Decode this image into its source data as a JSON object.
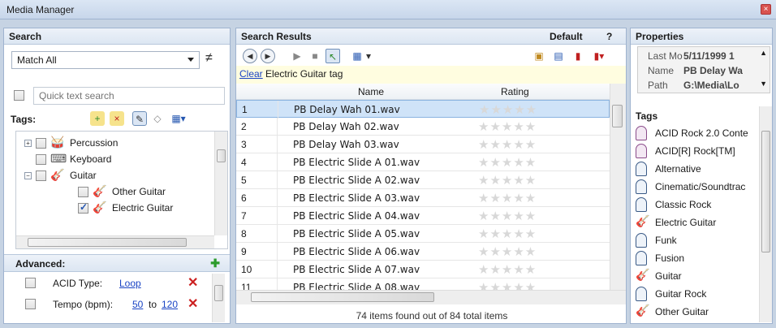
{
  "window": {
    "title": "Media Manager"
  },
  "search": {
    "header": "Search",
    "match_mode": "Match All",
    "not_equal_symbol": "≠",
    "quick_placeholder": "Quick text search",
    "tags_label": "Tags:",
    "tree": [
      {
        "label": "Percussion",
        "expander": "+",
        "checked": false,
        "icon": "drum-icon"
      },
      {
        "label": "Keyboard",
        "expander": "",
        "checked": false,
        "icon": "keyboard-icon"
      },
      {
        "label": "Guitar",
        "expander": "−",
        "checked": false,
        "icon": "guitar-icon"
      },
      {
        "label": "Other Guitar",
        "expander": "",
        "checked": false,
        "icon": "guitar-icon"
      },
      {
        "label": "Electric Guitar",
        "expander": "",
        "checked": true,
        "icon": "guitar-icon"
      }
    ],
    "advanced": {
      "label": "Advanced:",
      "acid_type_label": "ACID Type:",
      "acid_type_value": "Loop",
      "tempo_label": "Tempo (bpm):",
      "tempo_from": "50",
      "tempo_to_word": "to",
      "tempo_to": "120"
    }
  },
  "results": {
    "header": "Search Results",
    "preset": "Default",
    "help": "?",
    "clear_link": "Clear",
    "filter_text": "Electric Guitar tag",
    "columns": {
      "name": "Name",
      "rating": "Rating"
    },
    "rows": [
      {
        "num": "1",
        "name": "PB Delay Wah 01.wav",
        "rating": 0
      },
      {
        "num": "2",
        "name": "PB Delay Wah 02.wav",
        "rating": 0
      },
      {
        "num": "3",
        "name": "PB Delay Wah 03.wav",
        "rating": 0
      },
      {
        "num": "4",
        "name": "PB Electric Slide A 01.wav",
        "rating": 0
      },
      {
        "num": "5",
        "name": "PB Electric Slide A 02.wav",
        "rating": 0
      },
      {
        "num": "6",
        "name": "PB Electric Slide A 03.wav",
        "rating": 0
      },
      {
        "num": "7",
        "name": "PB Electric Slide A 04.wav",
        "rating": 0
      },
      {
        "num": "8",
        "name": "PB Electric Slide A 05.wav",
        "rating": 0
      },
      {
        "num": "9",
        "name": "PB Electric Slide A 06.wav",
        "rating": 0
      },
      {
        "num": "10",
        "name": "PB Electric Slide A 07.wav",
        "rating": 0
      },
      {
        "num": "11",
        "name": "PB Electric Slide A 08.wav",
        "rating": 0
      }
    ],
    "footer": "74 items found out of 84 total items"
  },
  "properties": {
    "header": "Properties",
    "fields": [
      {
        "key": "Last Mo",
        "value": "5/11/1999 1"
      },
      {
        "key": "Name",
        "value": "PB Delay Wa"
      },
      {
        "key": "Path",
        "value": "G:\\Media\\Lo"
      }
    ],
    "tags_header": "Tags",
    "tags": [
      {
        "label": "ACID Rock 2.0 Conte",
        "icon": "tag-pink-icon"
      },
      {
        "label": "ACID[R] Rock[TM]",
        "icon": "tag-pink-icon"
      },
      {
        "label": "Alternative",
        "icon": "tag-icon"
      },
      {
        "label": "Cinematic/Soundtrac",
        "icon": "tag-icon"
      },
      {
        "label": "Classic Rock",
        "icon": "tag-icon"
      },
      {
        "label": "Electric Guitar",
        "icon": "guitar-icon"
      },
      {
        "label": "Funk",
        "icon": "tag-icon"
      },
      {
        "label": "Fusion",
        "icon": "tag-icon"
      },
      {
        "label": "Guitar",
        "icon": "guitar-icon"
      },
      {
        "label": "Guitar Rock",
        "icon": "tag-icon"
      },
      {
        "label": "Other Guitar",
        "icon": "guitar-icon"
      }
    ]
  }
}
